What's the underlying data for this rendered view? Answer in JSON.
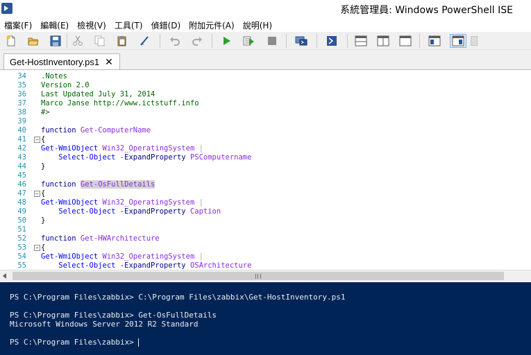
{
  "window": {
    "title": "系統管理員: Windows PowerShell ISE",
    "app_icon": "powershell-icon"
  },
  "menu": [
    {
      "label": "檔案(F)"
    },
    {
      "label": "編輯(E)"
    },
    {
      "label": "檢視(V)"
    },
    {
      "label": "工具(T)"
    },
    {
      "label": "偵錯(D)"
    },
    {
      "label": "附加元件(A)"
    },
    {
      "label": "說明(H)"
    }
  ],
  "toolbar": [
    {
      "name": "new-icon"
    },
    {
      "name": "open-icon"
    },
    {
      "name": "save-icon"
    },
    {
      "name": "cut-icon"
    },
    {
      "name": "copy-icon"
    },
    {
      "name": "paste-icon"
    },
    {
      "name": "clear-console-icon"
    },
    {
      "name": "undo-icon"
    },
    {
      "name": "redo-icon"
    },
    {
      "name": "run-icon"
    },
    {
      "name": "run-selection-icon"
    },
    {
      "name": "stop-icon"
    },
    {
      "name": "remote-powershell-icon"
    },
    {
      "name": "start-powershell-icon"
    },
    {
      "name": "show-script-pane-top-icon"
    },
    {
      "name": "show-script-pane-right-icon"
    },
    {
      "name": "show-script-pane-maximized-icon"
    },
    {
      "name": "show-command-window-icon"
    },
    {
      "name": "show-command-addon-icon"
    }
  ],
  "tabs": [
    {
      "label": "Get-HostInventory.ps1",
      "close": "✕"
    }
  ],
  "editor": {
    "lines": [
      {
        "n": "34",
        "fold": "",
        "parts": [
          {
            "t": ".Notes",
            "c": "c-comment"
          }
        ]
      },
      {
        "n": "35",
        "fold": "",
        "parts": [
          {
            "t": "Version 2.0",
            "c": "c-comment"
          }
        ]
      },
      {
        "n": "36",
        "fold": "",
        "parts": [
          {
            "t": "Last Updated July 31, 2014",
            "c": "c-comment"
          }
        ]
      },
      {
        "n": "37",
        "fold": "",
        "parts": [
          {
            "t": "Marco Janse http://www.ictstuff.info",
            "c": "c-comment"
          }
        ]
      },
      {
        "n": "38",
        "fold": "",
        "parts": [
          {
            "t": "#>",
            "c": "c-comment"
          }
        ]
      },
      {
        "n": "39",
        "fold": "",
        "parts": []
      },
      {
        "n": "40",
        "fold": "",
        "parts": [
          {
            "t": "function ",
            "c": "c-kw"
          },
          {
            "t": "Get-ComputerName",
            "c": "c-fn"
          }
        ]
      },
      {
        "n": "41",
        "fold": "−",
        "parts": [
          {
            "t": "{",
            "c": "c-plain"
          }
        ]
      },
      {
        "n": "42",
        "fold": "",
        "parts": [
          {
            "t": "Get-WmiObject ",
            "c": "c-cmd"
          },
          {
            "t": "Win32_OperatingSystem",
            "c": "c-arg"
          },
          {
            "t": " |",
            "c": "c-op"
          }
        ]
      },
      {
        "n": "43",
        "fold": "",
        "parts": [
          {
            "t": "    Select-Object ",
            "c": "c-cmd"
          },
          {
            "t": "-ExpandProperty ",
            "c": "c-param"
          },
          {
            "t": "PSComputername",
            "c": "c-arg"
          }
        ]
      },
      {
        "n": "44",
        "fold": "",
        "parts": [
          {
            "t": "}",
            "c": "c-plain"
          }
        ]
      },
      {
        "n": "45",
        "fold": "",
        "parts": []
      },
      {
        "n": "46",
        "fold": "",
        "parts": [
          {
            "t": "function ",
            "c": "c-kw"
          },
          {
            "t": "Get-OsFullDetails",
            "c": "c-fn hl"
          }
        ]
      },
      {
        "n": "47",
        "fold": "−",
        "parts": [
          {
            "t": "{",
            "c": "c-plain"
          }
        ]
      },
      {
        "n": "48",
        "fold": "",
        "parts": [
          {
            "t": "Get-WmiObject ",
            "c": "c-cmd"
          },
          {
            "t": "Win32_OperatingSystem",
            "c": "c-arg"
          },
          {
            "t": " |",
            "c": "c-op"
          }
        ]
      },
      {
        "n": "49",
        "fold": "",
        "parts": [
          {
            "t": "    Select-Object ",
            "c": "c-cmd"
          },
          {
            "t": "-ExpandProperty ",
            "c": "c-param"
          },
          {
            "t": "Caption",
            "c": "c-arg"
          }
        ]
      },
      {
        "n": "50",
        "fold": "",
        "parts": [
          {
            "t": "}",
            "c": "c-plain"
          }
        ]
      },
      {
        "n": "51",
        "fold": "",
        "parts": []
      },
      {
        "n": "52",
        "fold": "",
        "parts": [
          {
            "t": "function ",
            "c": "c-kw"
          },
          {
            "t": "Get-HWArchitecture",
            "c": "c-fn"
          }
        ]
      },
      {
        "n": "53",
        "fold": "−",
        "parts": [
          {
            "t": "{",
            "c": "c-plain"
          }
        ]
      },
      {
        "n": "54",
        "fold": "",
        "parts": [
          {
            "t": "Get-WmiObject ",
            "c": "c-cmd"
          },
          {
            "t": "Win32_OperatingSystem",
            "c": "c-arg"
          },
          {
            "t": " |",
            "c": "c-op"
          }
        ]
      },
      {
        "n": "55",
        "fold": "",
        "parts": [
          {
            "t": "    Select-Object ",
            "c": "c-cmd"
          },
          {
            "t": "-ExpandProperty ",
            "c": "c-param"
          },
          {
            "t": "OSArchitecture",
            "c": "c-arg"
          }
        ]
      }
    ]
  },
  "scrollbar": {
    "grip": "|||"
  },
  "console": {
    "lines": [
      "PS C:\\Program Files\\zabbix> C:\\Program Files\\zabbix\\Get-HostInventory.ps1",
      "",
      "PS C:\\Program Files\\zabbix> Get-OsFullDetails",
      "Microsoft Windows Server 2012 R2 Standard",
      "",
      "PS C:\\Program Files\\zabbix> "
    ]
  },
  "colors": {
    "console_bg": "#012456",
    "line_numbers": "#2b91af",
    "comment": "#006400",
    "keyword": "#00008b",
    "command": "#0000ff",
    "argument": "#8a2be2"
  }
}
